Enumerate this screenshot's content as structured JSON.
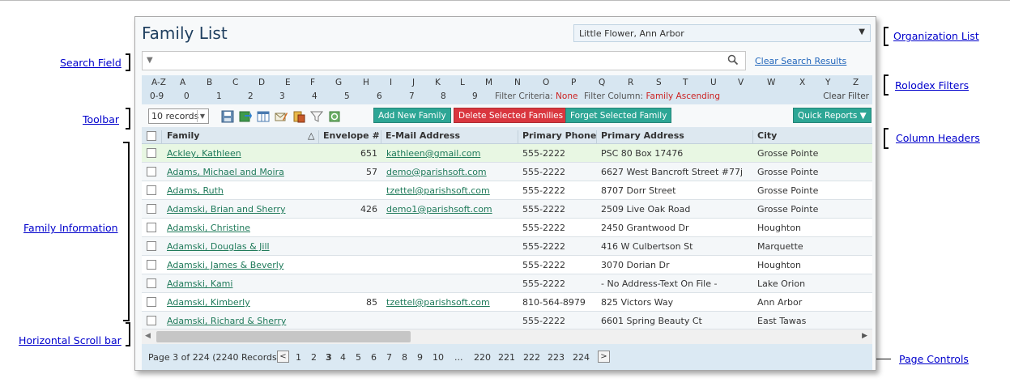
{
  "annotations": {
    "search_field": "Search Field",
    "toolbar": "Toolbar",
    "family_information": "Family Information",
    "horizontal_scroll_bar": "Horizontal Scroll bar",
    "organization_list": "Organization List",
    "rolodex_filters": "Rolodex Filters",
    "column_headers": "Column Headers",
    "page_controls": "Page Controls"
  },
  "header": {
    "title": "Family List",
    "organization": "Little Flower, Ann Arbor"
  },
  "search": {
    "value": "",
    "clear_label": "Clear Search Results"
  },
  "rolodex": {
    "letters": [
      "A-Z",
      "A",
      "B",
      "C",
      "D",
      "E",
      "F",
      "G",
      "H",
      "I",
      "J",
      "K",
      "L",
      "M",
      "N",
      "O",
      "P",
      "Q",
      "R",
      "S",
      "T",
      "U",
      "V",
      "W",
      "X",
      "Y",
      "Z"
    ],
    "digits": [
      "0-9",
      "0",
      "1",
      "2",
      "3",
      "4",
      "5",
      "6",
      "7",
      "8",
      "9"
    ],
    "filter_criteria_label": "Filter Criteria:",
    "filter_criteria_value": "None",
    "filter_column_label": "Filter Column:",
    "filter_column_value": "Family Ascending",
    "clear_filter": "Clear Filter"
  },
  "toolbar": {
    "records_select": "10 records",
    "add_button": "Add New Family",
    "delete_button": "Delete Selected Families",
    "forget_button": "Forget Selected Family",
    "quick_reports": "Quick Reports ▼"
  },
  "columns": {
    "family": "Family",
    "sort_indicator": "△",
    "envelope": "Envelope #",
    "email": "E-Mail Address",
    "phone": "Primary Phone",
    "address": "Primary Address",
    "city": "City"
  },
  "rows": [
    {
      "family": "Ackley, Kathleen",
      "envelope": "651",
      "email": "kathleen@gmail.com",
      "phone": "555-2222",
      "address": "PSC 80 Box 17476",
      "city": "Grosse Pointe"
    },
    {
      "family": "Adams, Michael and Moira",
      "envelope": "57",
      "email": "demo@parishsoft.com",
      "phone": "555-2222",
      "address": "6627 West Bancroft Street #77j",
      "city": "Grosse Pointe"
    },
    {
      "family": "Adams, Ruth",
      "envelope": "",
      "email": "tzettel@parishsoft.com",
      "phone": "555-2222",
      "address": "8707 Dorr Street",
      "city": "Grosse Pointe"
    },
    {
      "family": "Adamski, Brian and Sherry",
      "envelope": "426",
      "email": "demo1@parishsoft.com",
      "phone": "555-2222",
      "address": "2509 Live Oak Road",
      "city": "Grosse Pointe"
    },
    {
      "family": "Adamski, Christine",
      "envelope": "",
      "email": "",
      "phone": "555-2222",
      "address": "2450 Grantwood Dr",
      "city": "Houghton"
    },
    {
      "family": "Adamski, Douglas & Jill",
      "envelope": "",
      "email": "",
      "phone": "555-2222",
      "address": "416 W Culbertson St",
      "city": "Marquette"
    },
    {
      "family": "Adamski, James & Beverly",
      "envelope": "",
      "email": "",
      "phone": "555-2222",
      "address": "3070 Dorian Dr",
      "city": "Houghton"
    },
    {
      "family": "Adamski, Kami",
      "envelope": "",
      "email": "",
      "phone": "555-2222",
      "address": "- No Address-Text On File -",
      "city": "Lake Orion"
    },
    {
      "family": "Adamski, Kimberly",
      "envelope": "85",
      "email": "tzettel@parishsoft.com",
      "phone": "810-564-8979",
      "address": "825 Victors Way",
      "city": "Ann Arbor"
    },
    {
      "family": "Adamski, Richard & Sherry",
      "envelope": "",
      "email": "",
      "phone": "555-2222",
      "address": "6601 Spring Beauty Ct",
      "city": "East Tawas"
    }
  ],
  "pager": {
    "summary": "Page 3 of 224 (2240 Records)",
    "prev": "<",
    "next": ">",
    "pages": [
      "1",
      "2",
      "3",
      "4",
      "5",
      "6",
      "7",
      "8",
      "9",
      "10",
      "...",
      "220",
      "221",
      "222",
      "223",
      "224"
    ],
    "current": "3"
  },
  "colors": {
    "accent_green": "#2da695",
    "danger_red": "#d9363e",
    "link_green": "#1f7a5a",
    "header_blue": "#dde8f0"
  }
}
